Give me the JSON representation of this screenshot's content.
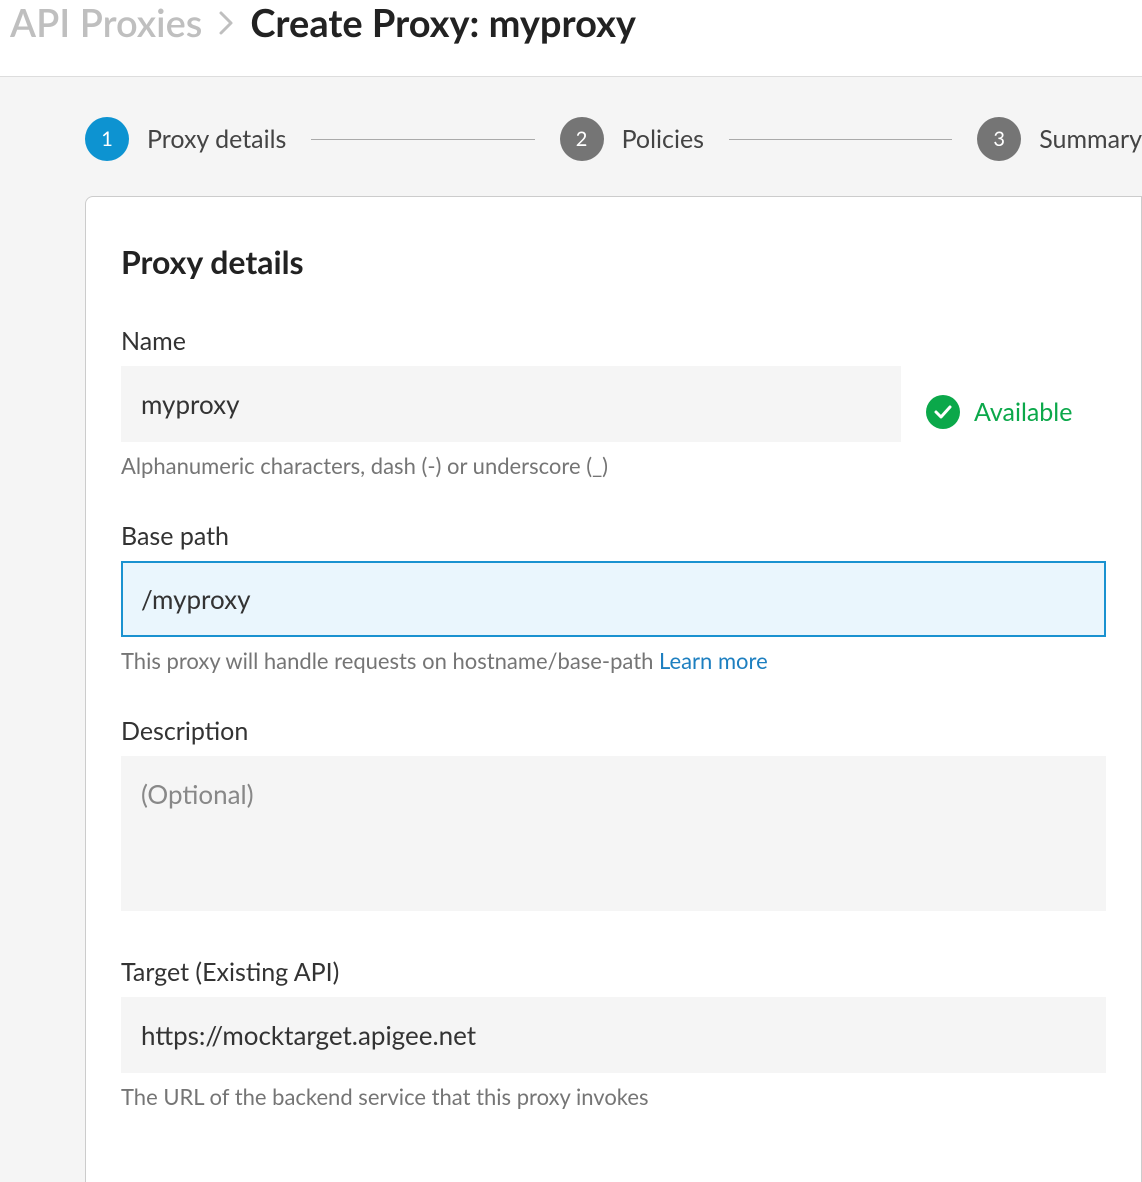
{
  "breadcrumb": {
    "parent": "API Proxies",
    "current": "Create Proxy: myproxy"
  },
  "stepper": {
    "steps": [
      {
        "number": "1",
        "label": "Proxy details",
        "active": true
      },
      {
        "number": "2",
        "label": "Policies",
        "active": false
      },
      {
        "number": "3",
        "label": "Summary",
        "active": false
      }
    ]
  },
  "card": {
    "title": "Proxy details"
  },
  "form": {
    "name": {
      "label": "Name",
      "value": "myproxy",
      "hint": "Alphanumeric characters, dash (-) or underscore (_)",
      "status": "Available"
    },
    "basepath": {
      "label": "Base path",
      "value": "/myproxy",
      "hint_text": "This proxy will handle requests on hostname/base-path ",
      "hint_link": "Learn more"
    },
    "description": {
      "label": "Description",
      "placeholder": "(Optional)"
    },
    "target": {
      "label": "Target (Existing API)",
      "value": "https://mocktarget.apigee.net",
      "hint": "The URL of the backend service that this proxy invokes"
    }
  }
}
